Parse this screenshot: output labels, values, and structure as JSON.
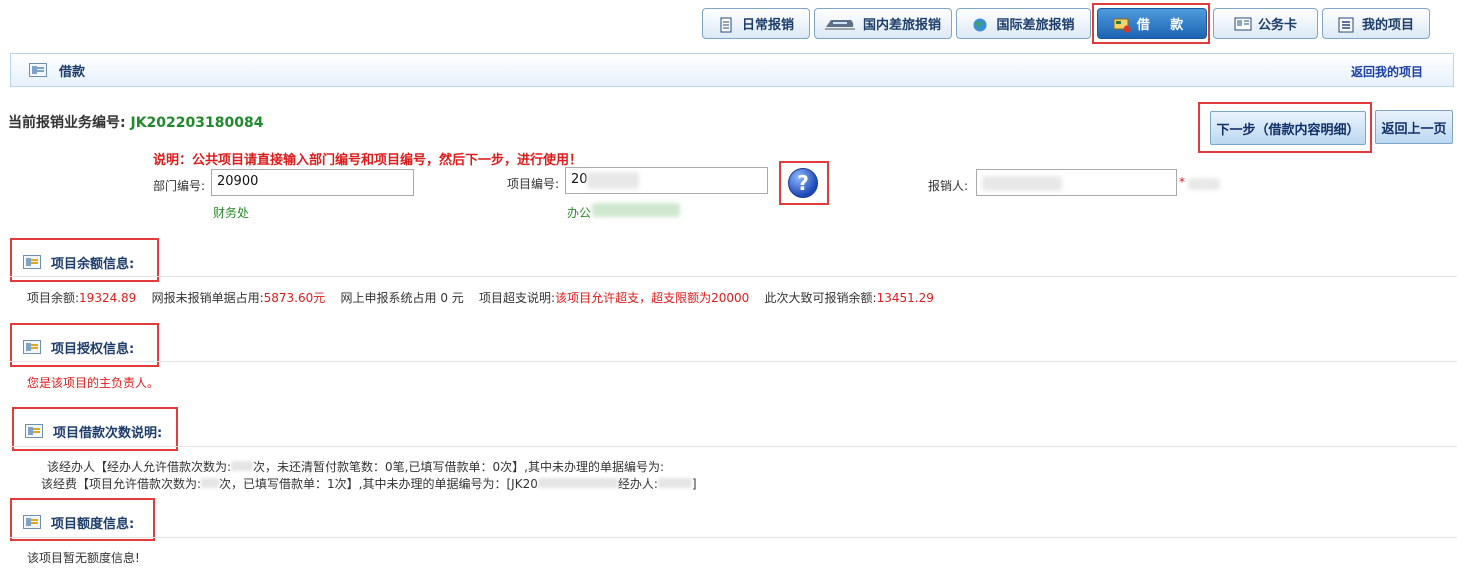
{
  "tabs": [
    {
      "label": "日常报销",
      "icon": "notebook-icon"
    },
    {
      "label": "国内差旅报销",
      "icon": "train-icon"
    },
    {
      "label": "国际差旅报销",
      "icon": "globe-icon"
    },
    {
      "label": "借  款",
      "icon": "card-icon",
      "active": true
    },
    {
      "label": "公务卡",
      "icon": "id-card-icon"
    },
    {
      "label": "我的项目",
      "icon": "list-icon"
    }
  ],
  "title_bar": {
    "title": "借款",
    "back_link": "返回我的项目"
  },
  "business": {
    "label": "当前报销业务编号:",
    "number": "JK202203180084"
  },
  "buttons": {
    "next": "下一步（借款内容明细）",
    "back": "返回上一页"
  },
  "note": "说明：公共项目请直接输入部门编号和项目编号，然后下一步，进行使用！",
  "form": {
    "dept_label": "部门编号:",
    "dept_value": "20900",
    "dept_name": "财务处",
    "project_label": "项目编号:",
    "project_value": "20",
    "project_name": "办公",
    "reimburser_label": "报销人:",
    "required_mark": "*"
  },
  "sections": {
    "balance": {
      "title": "项目余额信息:",
      "l1": "项目余额:",
      "v1": "19324.89",
      "l2": "网报未报销单据占用:",
      "v2": "5873.60元",
      "l3": "网上申报系统占用 0 元",
      "l4": "项目超支说明:",
      "v4": "该项目允许超支，超支限额为20000",
      "l5": "此次大致可报销余额:",
      "v5": "13451.29"
    },
    "auth": {
      "title": "项目授权信息:",
      "text": "您是该项目的主负责人。"
    },
    "loan_count": {
      "title": "项目借款次数说明:",
      "line1a": "该经办人【经办人允许借款次数为:",
      "line1b": "次，未还清暂付款笔数：0笔,已填写借款单：0次】,其中未办理的单据编号为:",
      "line2a": "该经费【项目允许借款次数为:",
      "line2b": "次，已填写借款单：1次】,其中未办理的单据编号为：[JK20",
      "line2c": "经办人:",
      "line2d": "]"
    },
    "quota": {
      "title": "项目额度信息:",
      "text": "该项目暂无额度信息!"
    }
  }
}
